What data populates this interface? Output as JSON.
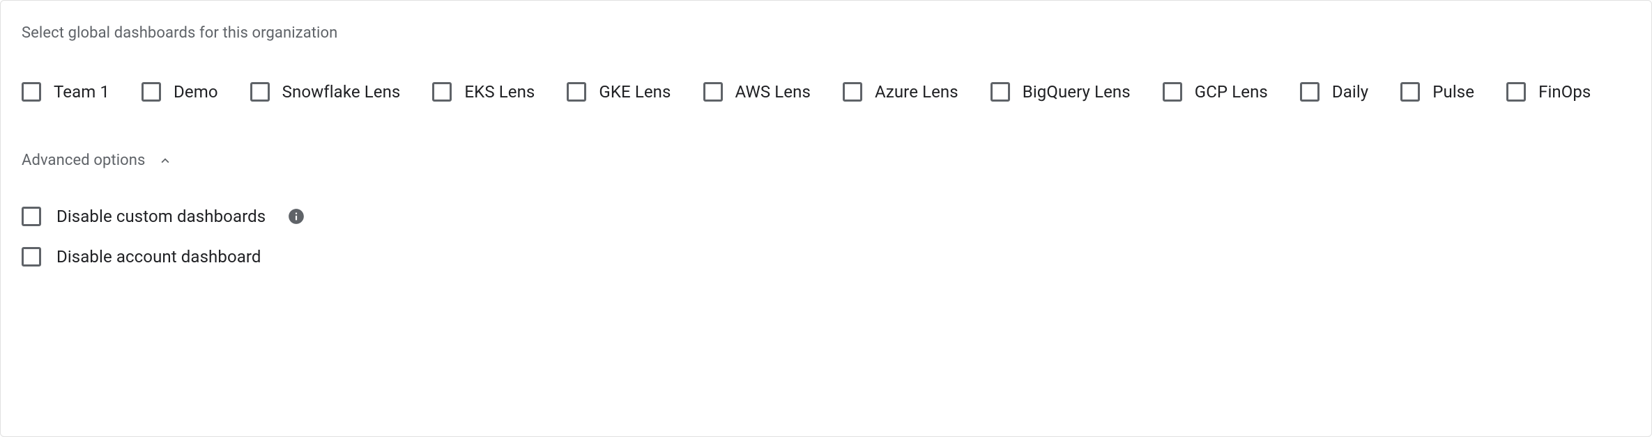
{
  "section": {
    "heading": "Select global dashboards for this organization"
  },
  "dashboards": [
    {
      "label": "Team 1"
    },
    {
      "label": "Demo"
    },
    {
      "label": "Snowflake Lens"
    },
    {
      "label": "EKS Lens"
    },
    {
      "label": "GKE Lens"
    },
    {
      "label": "AWS Lens"
    },
    {
      "label": "Azure Lens"
    },
    {
      "label": "BigQuery Lens"
    },
    {
      "label": "GCP Lens"
    },
    {
      "label": "Daily"
    },
    {
      "label": "Pulse"
    },
    {
      "label": "FinOps"
    }
  ],
  "advanced": {
    "toggle_label": "Advanced options",
    "options": [
      {
        "label": "Disable custom dashboards",
        "info": true
      },
      {
        "label": "Disable account dashboard",
        "info": false
      }
    ]
  }
}
